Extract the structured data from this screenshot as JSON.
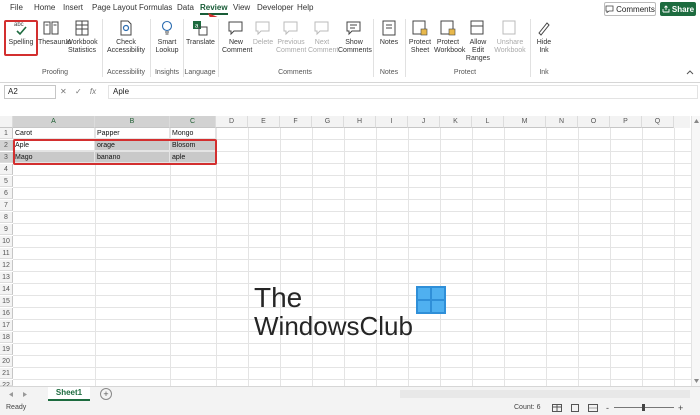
{
  "menu": {
    "tabs": [
      "File",
      "Home",
      "Insert",
      "Page Layout",
      "Formulas",
      "Data",
      "Review",
      "View",
      "Developer",
      "Help"
    ],
    "active": "Review",
    "comments_button": "Comments",
    "share_button": "Share"
  },
  "ribbon": {
    "proofing": {
      "label": "Proofing",
      "spelling": "Spelling",
      "spelling_icon_text": "abc",
      "thesaurus": "Thesaurus",
      "workbook_stats": "Workbook Statistics"
    },
    "accessibility": {
      "label": "Accessibility",
      "check": "Check Accessibility"
    },
    "insights": {
      "label": "Insights",
      "smart_lookup": "Smart Lookup"
    },
    "language": {
      "label": "Language",
      "translate": "Translate"
    },
    "comments": {
      "label": "Comments",
      "new": "New Comment",
      "delete": "Delete",
      "previous": "Previous Comment",
      "next": "Next Comment",
      "show": "Show Comments"
    },
    "notes": {
      "label": "Notes",
      "notes": "Notes"
    },
    "protect": {
      "label": "Protect",
      "protect_sheet": "Protect Sheet",
      "protect_workbook": "Protect Workbook",
      "allow_edit": "Allow Edit Ranges",
      "unshare": "Unshare Workbook"
    },
    "ink": {
      "label": "Ink",
      "hide_ink": "Hide Ink"
    }
  },
  "formula_bar": {
    "name_box": "A2",
    "fx": "fx",
    "value": "Aple"
  },
  "sheet": {
    "columns": [
      "A",
      "B",
      "C",
      "D",
      "E",
      "F",
      "G",
      "H",
      "I",
      "J",
      "K",
      "L",
      "M",
      "N",
      "O",
      "P",
      "Q"
    ],
    "rows": [
      "1",
      "2",
      "3",
      "4",
      "5",
      "6",
      "7",
      "8",
      "9",
      "10",
      "11",
      "12",
      "13",
      "14",
      "15",
      "16",
      "17",
      "18",
      "19",
      "20",
      "21",
      "22"
    ],
    "cells": [
      [
        "Carot",
        "Papper",
        "Mongo"
      ],
      [
        "Aple",
        "orage",
        "Blosom"
      ],
      [
        "Mago",
        "banano",
        "aple"
      ]
    ],
    "tab": "Sheet1",
    "add_sheet": "+"
  },
  "status": {
    "ready": "Ready",
    "count": "Count: 6",
    "zoom_minus": "-",
    "zoom_plus": "+"
  },
  "watermark": {
    "line1": "The",
    "line2": "WindowsClub"
  },
  "colors": {
    "accent": "#1d6b3f",
    "highlight": "#d32f2f",
    "selection": "#c9c9c9"
  }
}
